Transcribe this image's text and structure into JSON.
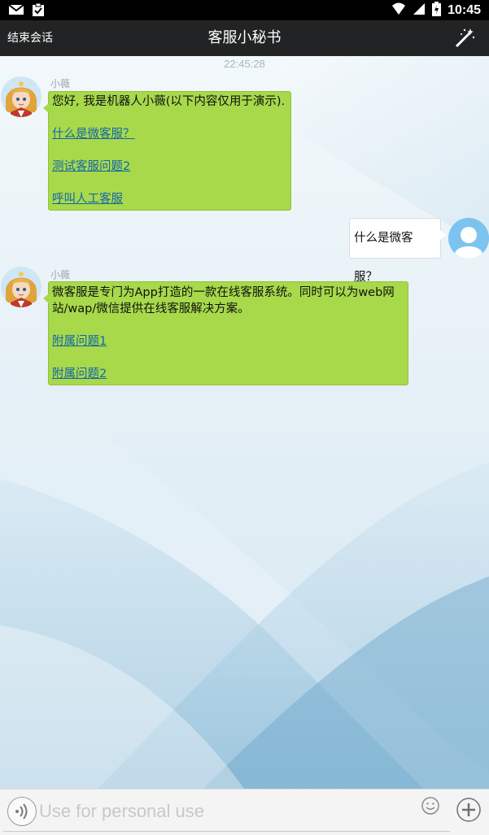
{
  "status_bar": {
    "time": "10:45",
    "icons": [
      "gmail-icon",
      "clipboard-icon",
      "wifi-icon",
      "signal-icon",
      "battery-icon"
    ]
  },
  "title_bar": {
    "end_session_label": "结束会话",
    "title": "客服小秘书",
    "magic_icon": "magic-wand-icon"
  },
  "chat": {
    "timestamp": "22:45:28",
    "messages": [
      {
        "sender": "bot",
        "name": "小薇",
        "text": "您好, 我是机器人小薇(以下内容仅用于演示).",
        "links": [
          "什么是微客服？",
          "测试客服问题2",
          "呼叫人工客服"
        ]
      },
      {
        "sender": "user",
        "text": "什么是微客服？"
      },
      {
        "sender": "bot",
        "name": "小薇",
        "text_line1": "微客服是专门为App打造的一款在线客服系统。同时可以为web网",
        "text_line2": "站/wap/微信提供在线客服解决方案。",
        "links": [
          "附属问题1",
          "附属问题2"
        ]
      }
    ]
  },
  "input_bar": {
    "placeholder": "Use for personal use",
    "voice_icon": "voice-icon",
    "emoji_icon": "smiley-icon",
    "plus_icon": "plus-icon"
  },
  "colors": {
    "bot_bubble": "#a7d94b",
    "user_bubble": "#ffffff",
    "link": "#1566a8",
    "title_bar": "#222324",
    "status_bar": "#000000"
  }
}
